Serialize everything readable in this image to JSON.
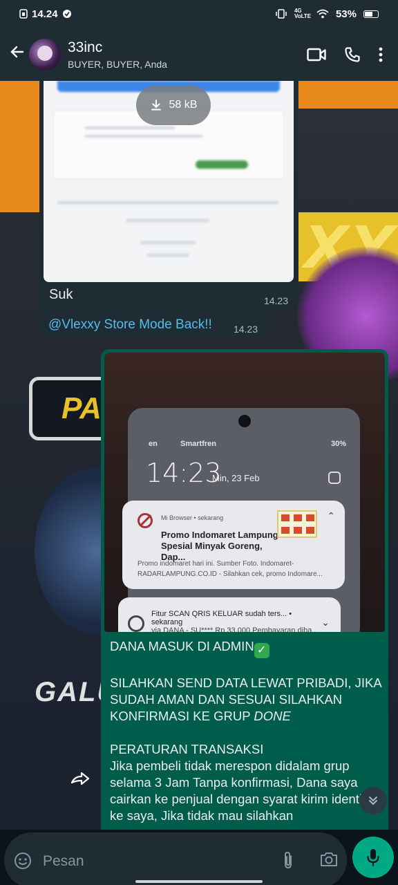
{
  "status_bar": {
    "time": "14.24",
    "network": "4G VoLTE",
    "battery": "53%"
  },
  "header": {
    "title": "33inc",
    "subtitle": "BUYER, BUYER, Anda"
  },
  "messages": [
    {
      "type": "image",
      "download_size": "58 kB",
      "caption": "Suk",
      "time": "14.23"
    },
    {
      "type": "mention",
      "text": "@Vlexxy Store Mode Back!!",
      "time": "14.23"
    },
    {
      "type": "image_text",
      "image": {
        "carrier": "en",
        "network": "Smartfren",
        "battery": "30%",
        "clock": "14:23",
        "date": "Min, 23 Feb",
        "notification1": {
          "app": "Mi Browser • sekarang",
          "title": "Promo Indomaret Lampung Spesial Minyak Goreng, Dap...",
          "body": "Promo indomaret hari ini. Sumber Foto. Indomaret-RADARLAMPUNG.CO.ID - Silahkan cek, promo Indomare..."
        },
        "notification2": {
          "title": "Fitur SCAN QRIS KELUAR sudah ters... • sekarang",
          "body": "via DANA - SU**** Rp 33.000 Pembayaran diba..."
        }
      },
      "text_lines": {
        "line1": "DANA MASUK DI ADMIN",
        "line2": "SILAHKAN SEND DATA LEWAT PRIBADI, JIKA SUDAH AMAN DAN SESUAI SILAHKAN KONFIRMASI KE GRUP",
        "line2_italic": "DONE",
        "line3": "PERATURAN TRANSAKSI",
        "line4": "Jika pembeli tidak merespon didalam grup selama 3 Jam Tanpa konfirmasi, Dana saya cairkan ke penjual dengan syarat kirim identitas ke saya, Jika tidak mau silahkan"
      }
    }
  ],
  "background": {
    "text_top": "XY",
    "text_pa": "PA",
    "text_gal": "GALU"
  },
  "composer": {
    "placeholder": "Pesan"
  },
  "icons": [
    "back-arrow-icon",
    "video-call-icon",
    "phone-call-icon",
    "more-icon",
    "download-icon",
    "forward-icon",
    "scroll-down-icon",
    "sticker-icon",
    "attach-icon",
    "camera-icon",
    "mic-icon"
  ],
  "colors": {
    "header": "#1f2c34",
    "incoming_bubble": "#202c33",
    "outgoing_bubble": "#005c4b",
    "mention": "#53bdeb",
    "mic_button": "#00a884"
  }
}
